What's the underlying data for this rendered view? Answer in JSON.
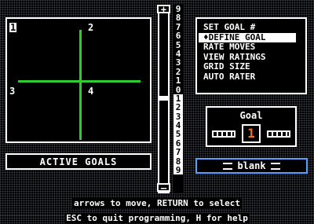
{
  "playfield": {
    "quadrants": [
      "1",
      "2",
      "3",
      "4"
    ]
  },
  "active_goals_label": "ACTIVE GOALS",
  "slider": {
    "top_symbol": "+",
    "bottom_symbol": "–"
  },
  "scale": [
    "9",
    "8",
    "7",
    "6",
    "5",
    "4",
    "3",
    "2",
    "1",
    "0",
    "1",
    "2",
    "3",
    "4",
    "5",
    "6",
    "7",
    "8",
    "9"
  ],
  "menu": {
    "items": [
      {
        "label": "SET GOAL #",
        "selected": false
      },
      {
        "label": "♦DEFINE GOAL",
        "selected": true
      },
      {
        "label": "RATE MOVES",
        "selected": false
      },
      {
        "label": "VIEW RATINGS",
        "selected": false
      },
      {
        "label": "GRID SIZE",
        "selected": false
      },
      {
        "label": "AUTO RATER",
        "selected": false
      }
    ]
  },
  "goal": {
    "title": "Goal",
    "value": "1"
  },
  "blank_field": {
    "label": "blank"
  },
  "instructions": {
    "line1": "arrows to move, RETURN to select",
    "line2": "ESC to quit programming, H for help"
  },
  "colors": {
    "grid_lines": "#2ecc2e",
    "goal_number": "#ff6a1a",
    "blank_border": "#5aa0ff"
  }
}
